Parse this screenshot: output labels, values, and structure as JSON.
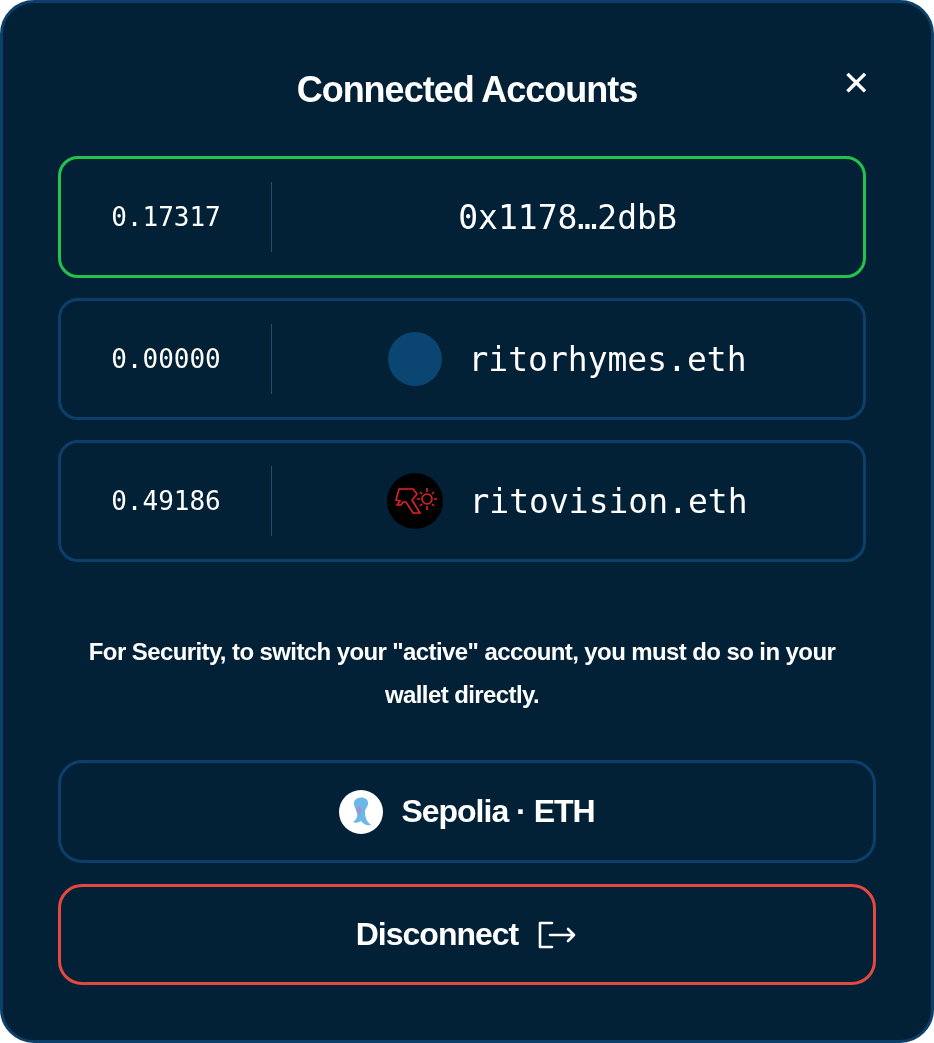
{
  "title": "Connected Accounts",
  "close": "✕",
  "accounts": [
    {
      "balance": "0.17317",
      "name": "0x1178…2dbB",
      "selected": true,
      "kind": "plain"
    },
    {
      "balance": "0.00000",
      "name": "ritorhymes.eth",
      "selected": false,
      "kind": "avatar"
    },
    {
      "balance": "0.49186",
      "name": "ritovision.eth",
      "selected": false,
      "kind": "logo"
    }
  ],
  "note": "For Security, to switch your \"active\" account, you must do so in your wallet directly.",
  "network_button": {
    "label": "Sepolia · ETH"
  },
  "disconnect_button": {
    "label": "Disconnect"
  }
}
